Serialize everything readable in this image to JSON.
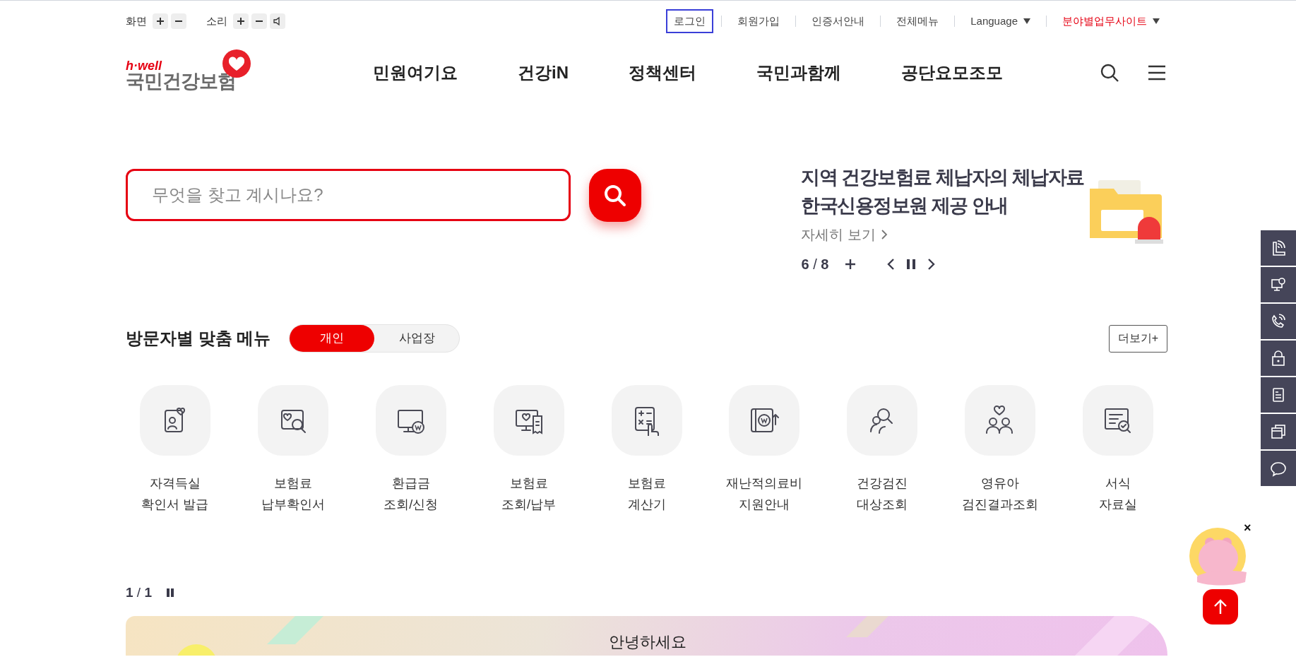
{
  "utility_bar": {
    "zoom_label": "화면",
    "sound_label": "소리"
  },
  "top_links": [
    {
      "label": "로그인",
      "focused": true,
      "dropdown": false,
      "color": "#444444"
    },
    {
      "label": "회원가입",
      "focused": false,
      "dropdown": false,
      "color": "#444444"
    },
    {
      "label": "인증서안내",
      "focused": false,
      "dropdown": false,
      "color": "#444444"
    },
    {
      "label": "전체메뉴",
      "focused": false,
      "dropdown": false,
      "color": "#444444"
    },
    {
      "label": "Language",
      "focused": false,
      "dropdown": true,
      "color": "#444444"
    },
    {
      "label": "분야별업무사이트",
      "focused": false,
      "dropdown": true,
      "color": "#e60012"
    }
  ],
  "logo": {
    "tagline": "h·well",
    "name": "국민건강보험"
  },
  "nav": [
    "민원여기요",
    "건강iN",
    "정책센터",
    "국민과함께",
    "공단요모조모"
  ],
  "search": {
    "placeholder": "무엇을 찾고 계시나요?"
  },
  "notice": {
    "title_lines": [
      "지역 건강보험료 체납자의 체납자료",
      "한국신용정보원 제공 안내"
    ],
    "link": "자세히 보기",
    "counter": "**6** / **8**"
  },
  "visitor_menu": {
    "title": "방문자별 맞춤 메뉴",
    "tabs": [
      {
        "label": "개인",
        "selected": true
      },
      {
        "label": "사업장",
        "selected": false
      }
    ],
    "more": "더보기+",
    "items": [
      {
        "label_lines": [
          "자격득실",
          "확인서 발급"
        ]
      },
      {
        "label_lines": [
          "보험료",
          "납부확인서"
        ]
      },
      {
        "label_lines": [
          "환급금",
          "조회/신청"
        ]
      },
      {
        "label_lines": [
          "보험료",
          "조회/납부"
        ]
      },
      {
        "label_lines": [
          "보험료",
          "계산기"
        ]
      },
      {
        "label_lines": [
          "재난적의료비",
          "지원안내"
        ]
      },
      {
        "label_lines": [
          "건강검진",
          "대상조회"
        ]
      },
      {
        "label_lines": [
          "영유아",
          "검진결과조회"
        ]
      },
      {
        "label_lines": [
          "서식",
          "자료실"
        ]
      }
    ]
  },
  "carousel": {
    "counter": "**1** / **1**"
  },
  "banner": {
    "greeting": "안녕하세요"
  },
  "mascot_close": "×"
}
